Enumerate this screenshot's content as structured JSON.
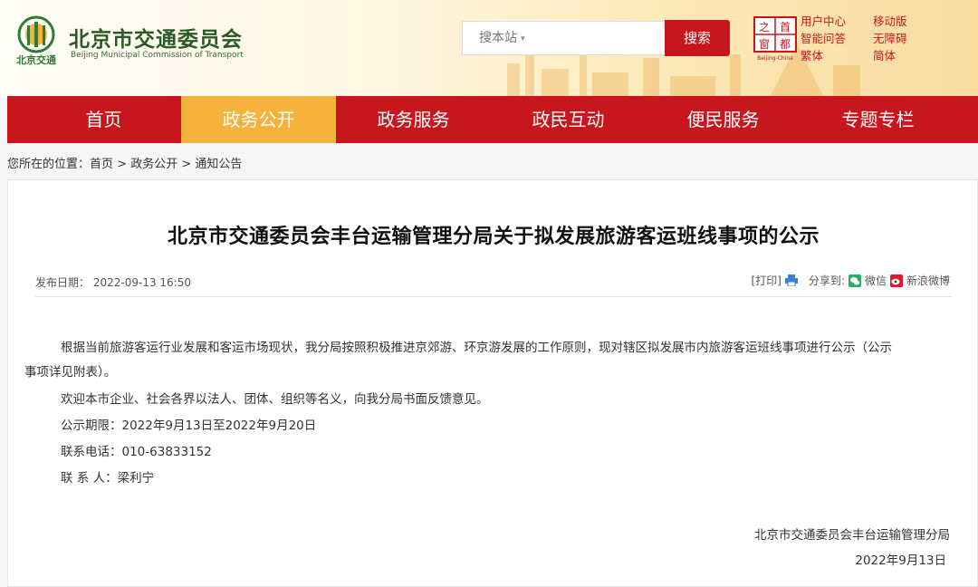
{
  "header": {
    "org_name": "北京市交通委员会",
    "org_name_en": "Beijing Municipal Commission of Transport",
    "logo_text": "北京交通",
    "search_placeholder": "搜本站",
    "search_button": "搜索",
    "shoudu_caption": "Beijing-China",
    "links": [
      "用户中心",
      "移动版",
      "智能问答",
      "无障碍",
      "繁体",
      "简体"
    ]
  },
  "nav": {
    "items": [
      "首页",
      "政务公开",
      "政务服务",
      "政民互动",
      "便民服务",
      "专题专栏"
    ],
    "active_index": 1,
    "color": "#c8161e",
    "active_color": "#f5b23c"
  },
  "breadcrumb": {
    "label": "您所在的位置：",
    "path": [
      "首页",
      "政务公开",
      "通知公告"
    ],
    "separator": " > "
  },
  "article": {
    "title": "北京市交通委员会丰台运输管理分局关于拟发展旅游客运班线事项的公示",
    "publish_label": "发布日期：",
    "publish_date": "2022-09-13 16:50",
    "print_label": "[打印]",
    "share_label": "分享到:",
    "share_wechat": "微信",
    "share_weibo": "新浪微博",
    "para1_line1": "根据当前旅游客运行业发展和客运市场现状，我分局按照积极推进京郊游、环京游发展的工作原则，现对辖区拟发展市内旅游客运班线事项进行公示（公示",
    "para1_line2": "事项详见附表）。",
    "para2": "欢迎本市企业、社会各界以法人、团体、组织等名义，向我分局书面反馈意见。",
    "period": "公示期限：2022年9月13日至2022年9月20日",
    "phone": "联系电话：010-63833152",
    "contact": "联 系 人：梁利宁",
    "sign_org": "北京市交通委员会丰台运输管理分局",
    "sign_date": "2022年9月13日"
  }
}
